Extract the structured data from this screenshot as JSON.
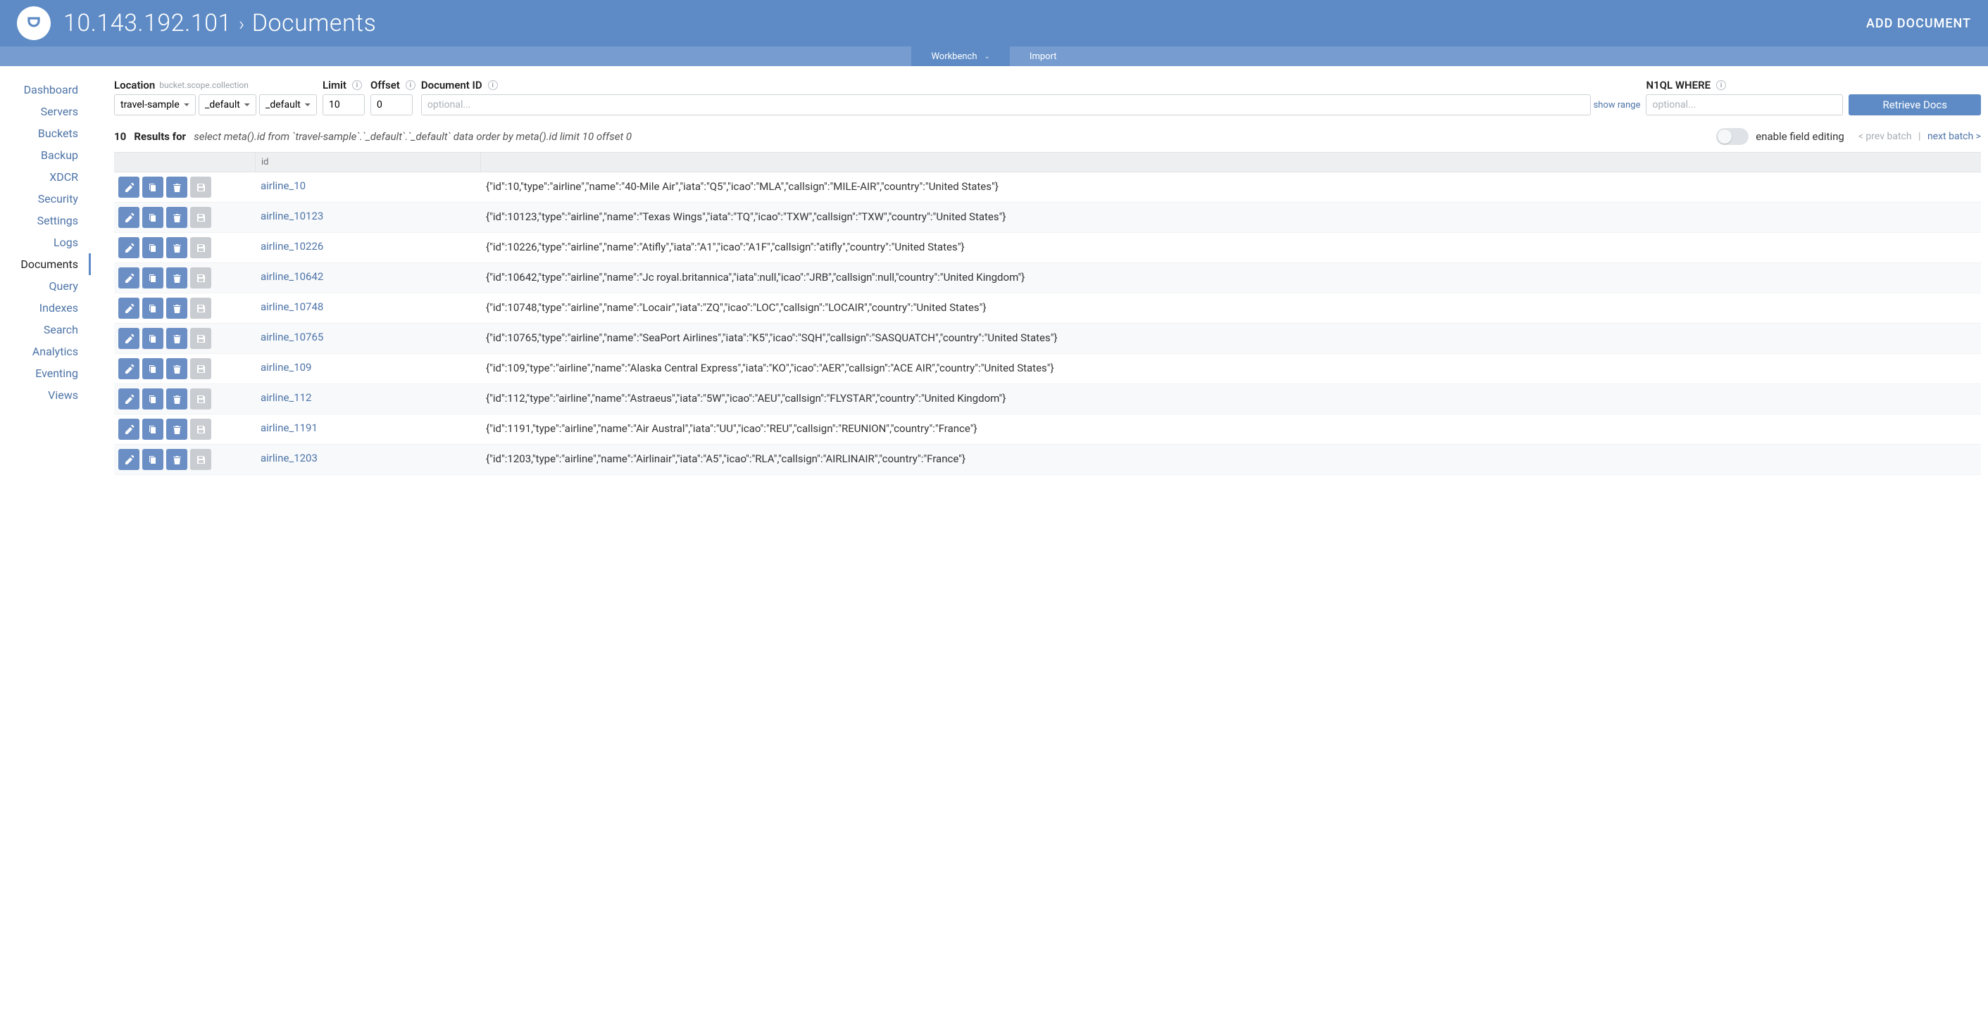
{
  "header": {
    "host": "10.143.192.101",
    "page_title": "Documents",
    "add_document": "ADD DOCUMENT"
  },
  "subnav": {
    "workbench": "Workbench",
    "import": "Import"
  },
  "sidebar": {
    "items": [
      "Dashboard",
      "Servers",
      "Buckets",
      "Backup",
      "XDCR",
      "Security",
      "Settings",
      "Logs",
      "Documents",
      "Query",
      "Indexes",
      "Search",
      "Analytics",
      "Eventing",
      "Views"
    ],
    "active_index": 8
  },
  "filters": {
    "location_label": "Location",
    "location_hint": "bucket.scope.collection",
    "bucket": "travel-sample",
    "scope": "_default",
    "collection": "_default",
    "limit_label": "Limit",
    "limit_value": "10",
    "offset_label": "Offset",
    "offset_value": "0",
    "docid_label": "Document ID",
    "docid_placeholder": "optional...",
    "show_range": "show range",
    "where_label": "N1QL WHERE",
    "where_placeholder": "optional...",
    "retrieve": "Retrieve Docs"
  },
  "results": {
    "count": "10",
    "label_prefix": "Results for",
    "query": "select meta().id from `travel-sample`.`_default`.`_default` data order by meta().id limit 10 offset 0",
    "toggle_label": "enable field editing",
    "prev": "< prev batch",
    "next": "next batch >"
  },
  "columns": {
    "id": "id"
  },
  "docs": [
    {
      "id": "airline_10",
      "json": "{\"id\":10,\"type\":\"airline\",\"name\":\"40-Mile Air\",\"iata\":\"Q5\",\"icao\":\"MLA\",\"callsign\":\"MILE-AIR\",\"country\":\"United States\"}"
    },
    {
      "id": "airline_10123",
      "json": "{\"id\":10123,\"type\":\"airline\",\"name\":\"Texas Wings\",\"iata\":\"TQ\",\"icao\":\"TXW\",\"callsign\":\"TXW\",\"country\":\"United States\"}"
    },
    {
      "id": "airline_10226",
      "json": "{\"id\":10226,\"type\":\"airline\",\"name\":\"Atifly\",\"iata\":\"A1\",\"icao\":\"A1F\",\"callsign\":\"atifly\",\"country\":\"United States\"}"
    },
    {
      "id": "airline_10642",
      "json": "{\"id\":10642,\"type\":\"airline\",\"name\":\"Jc royal.britannica\",\"iata\":null,\"icao\":\"JRB\",\"callsign\":null,\"country\":\"United Kingdom\"}"
    },
    {
      "id": "airline_10748",
      "json": "{\"id\":10748,\"type\":\"airline\",\"name\":\"Locair\",\"iata\":\"ZQ\",\"icao\":\"LOC\",\"callsign\":\"LOCAIR\",\"country\":\"United States\"}"
    },
    {
      "id": "airline_10765",
      "json": "{\"id\":10765,\"type\":\"airline\",\"name\":\"SeaPort Airlines\",\"iata\":\"K5\",\"icao\":\"SQH\",\"callsign\":\"SASQUATCH\",\"country\":\"United States\"}"
    },
    {
      "id": "airline_109",
      "json": "{\"id\":109,\"type\":\"airline\",\"name\":\"Alaska Central Express\",\"iata\":\"KO\",\"icao\":\"AER\",\"callsign\":\"ACE AIR\",\"country\":\"United States\"}"
    },
    {
      "id": "airline_112",
      "json": "{\"id\":112,\"type\":\"airline\",\"name\":\"Astraeus\",\"iata\":\"5W\",\"icao\":\"AEU\",\"callsign\":\"FLYSTAR\",\"country\":\"United Kingdom\"}"
    },
    {
      "id": "airline_1191",
      "json": "{\"id\":1191,\"type\":\"airline\",\"name\":\"Air Austral\",\"iata\":\"UU\",\"icao\":\"REU\",\"callsign\":\"REUNION\",\"country\":\"France\"}"
    },
    {
      "id": "airline_1203",
      "json": "{\"id\":1203,\"type\":\"airline\",\"name\":\"Airlinair\",\"iata\":\"A5\",\"icao\":\"RLA\",\"callsign\":\"AIRLINAIR\",\"country\":\"France\"}"
    }
  ]
}
